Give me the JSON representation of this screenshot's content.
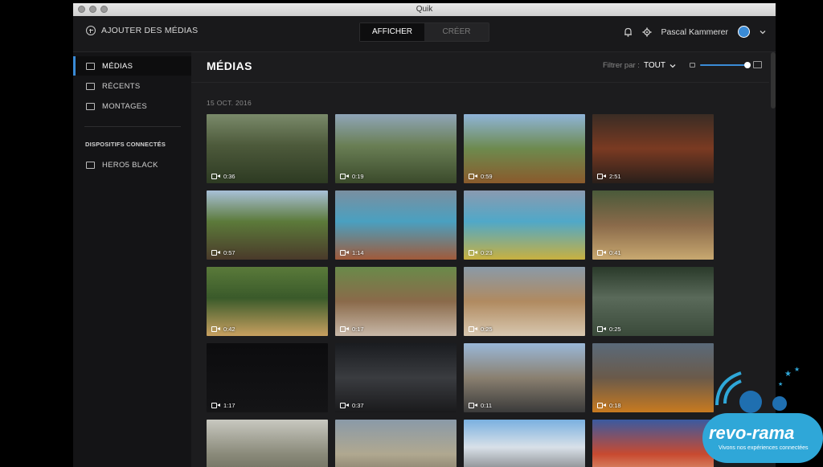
{
  "window": {
    "title": "Quik"
  },
  "header": {
    "add_media_label": "AJOUTER DES MÉDIAS",
    "tabs": [
      {
        "label": "AFFICHER",
        "active": true
      },
      {
        "label": "CRÉER",
        "active": false
      }
    ],
    "user_name": "Pascal Kammerer"
  },
  "sidebar": {
    "items": [
      {
        "label": "MÉDIAS",
        "active": true
      },
      {
        "label": "RÉCENTS",
        "active": false
      },
      {
        "label": "MONTAGES",
        "active": false
      }
    ],
    "devices_label": "DISPOSITIFS CONNECTÉS",
    "devices": [
      {
        "label": "HERO5 BLACK"
      }
    ]
  },
  "main": {
    "title": "MÉDIAS",
    "filter_label": "Filtrer par :",
    "filter_value": "TOUT",
    "date_label": "15 OCT. 2016",
    "zoom_level": 1.0
  },
  "media": [
    {
      "duration": "0:36"
    },
    {
      "duration": "0:19"
    },
    {
      "duration": "0:59"
    },
    {
      "duration": "2:51"
    },
    {
      "duration": "0:57"
    },
    {
      "duration": "1:14"
    },
    {
      "duration": "0:23"
    },
    {
      "duration": "0:41"
    },
    {
      "duration": "0:42"
    },
    {
      "duration": "0:17"
    },
    {
      "duration": "0:25"
    },
    {
      "duration": "0:25"
    },
    {
      "duration": "1:17"
    },
    {
      "duration": "0:37"
    },
    {
      "duration": "0:11"
    },
    {
      "duration": "0:18"
    },
    {
      "duration": ""
    },
    {
      "duration": ""
    },
    {
      "duration": ""
    },
    {
      "duration": ""
    }
  ],
  "watermark": {
    "brand": "revo-rama",
    "tagline": "Vivons nos expériences connectées"
  },
  "colors": {
    "accent": "#3a8bd6",
    "window_bg": "#1c1c1e",
    "sidebar_bg": "#141416",
    "brand": "#2fa7d8"
  }
}
